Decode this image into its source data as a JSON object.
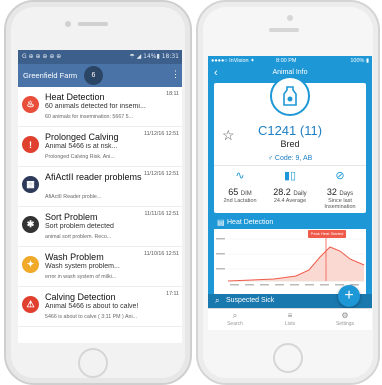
{
  "left_phone": {
    "status_bar": {
      "left": "G ⊕ ⊕ ⊕ ⊕ ⊕",
      "right": "☂ ◢ 14%▮ 18:31"
    },
    "app_bar": {
      "farm_name": "Greenfield Farm",
      "badge_count": "6",
      "menu_icon": "kebab-menu-icon"
    },
    "notifications": [
      {
        "icon": "heat-icon",
        "icon_color": "#e94e3b",
        "icon_glyph": "♨",
        "title": "Heat Detection",
        "line1": "60 animals detected for insemi...",
        "line2": "60 animals for insemination: 5667   5...",
        "time": "18:11"
      },
      {
        "icon": "warning-icon",
        "icon_color": "#e0412f",
        "icon_glyph": "!",
        "title": "Prolonged Calving",
        "line1": "Animal 5466 is at risk...",
        "line2": "Prolonged Calving Risk.   Ani...",
        "time": "11/12/16 12:51"
      },
      {
        "icon": "calendar-icon",
        "icon_color": "#2e3a59",
        "icon_glyph": "▦",
        "title": "AfiActII reader problems",
        "line1": "",
        "line2": "AfiActII Reader proble...",
        "time": "11/12/16 12:51"
      },
      {
        "icon": "sort-icon",
        "icon_color": "#333333",
        "icon_glyph": "✱",
        "title": "Sort Problem",
        "line1": "Sort problem detected",
        "line2": "animal sort problem.   Reco...",
        "time": "11/11/16 12:51"
      },
      {
        "icon": "wash-icon",
        "icon_color": "#f0a928",
        "icon_glyph": "✦",
        "title": "Wash Problem",
        "line1": "Wash system problem...",
        "line2": "error in wash system of milki...",
        "time": "11/10/16 12:51"
      },
      {
        "icon": "calving-icon",
        "icon_color": "#e0412f",
        "icon_glyph": "⚠",
        "title": "Calving Detection",
        "line1": "Animal 5466 is about to calve!",
        "line2": "5466 is about to calve ( 3:11 PM )   Ani...",
        "time": "17:11"
      }
    ]
  },
  "right_phone": {
    "status_bar": {
      "left": "●●●●○ InVision ✦",
      "center": "8:00 PM",
      "right": "100% ▮"
    },
    "nav": {
      "title": "Animal Info",
      "back": "‹"
    },
    "animal": {
      "id": "C1241 (11)",
      "status": "Bred",
      "code": "Code: 9, AB"
    },
    "stats": [
      {
        "icon": "lactation-curve-icon",
        "glyph": "∿",
        "value": "65",
        "unit": "DIM",
        "sub": "2nd Lactation"
      },
      {
        "icon": "milk-chart-icon",
        "glyph": "▮▯",
        "value": "28.2",
        "unit": "Daily",
        "sub": "24.4 Average"
      },
      {
        "icon": "insemination-icon",
        "glyph": "⊘",
        "value": "32",
        "unit": "Days",
        "sub": "Since last Insemination"
      }
    ],
    "chart": {
      "title": "Heat Detection",
      "marker_label": "Peak Heat Started",
      "accent": "#f05a4a"
    },
    "suspected": "Suspected Sick",
    "fab": "+",
    "tabs": [
      {
        "icon": "search-icon",
        "glyph": "⌕",
        "label": "Search"
      },
      {
        "icon": "list-icon",
        "glyph": "≡",
        "label": "Lists"
      },
      {
        "icon": "settings-icon",
        "glyph": "⚙",
        "label": "Settings"
      }
    ]
  }
}
